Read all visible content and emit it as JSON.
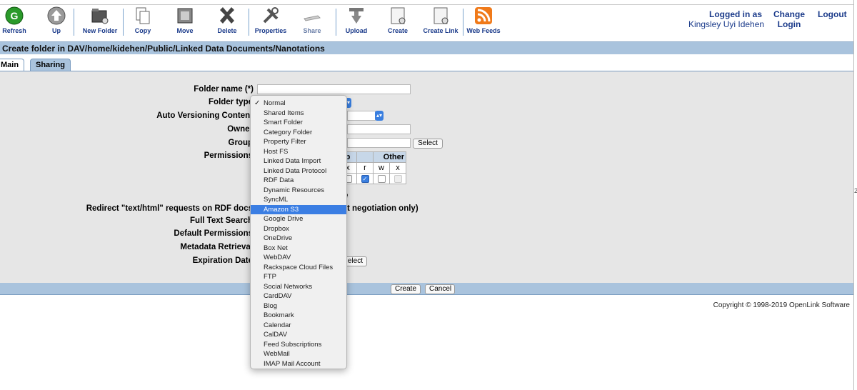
{
  "toolbar": {
    "refresh": "Refresh",
    "up": "Up",
    "new_folder": "New Folder",
    "copy": "Copy",
    "move": "Move",
    "delete": "Delete",
    "properties": "Properties",
    "share": "Share",
    "upload": "Upload",
    "create": "Create",
    "create_link": "Create Link",
    "web_feeds": "Web Feeds"
  },
  "user": {
    "logged_in_as": "Logged in as",
    "name": "Kingsley Uyi Idehen",
    "change_line1": "Change",
    "change_line2": "Login",
    "logout": "Logout"
  },
  "title": "Create folder in DAV/home/kidehen/Public/Linked Data Documents/Nanotations",
  "tabs": {
    "main": "Main",
    "sharing": "Sharing"
  },
  "form": {
    "folder_name_label": "Folder name (*)",
    "folder_type_label": "Folder type",
    "auto_versioning_label": "Auto Versioning Content",
    "owner_label": "Owner",
    "group_label": "Group",
    "group_select": "Select",
    "permissions_label": "Permissions",
    "perm_group_fragment": "p",
    "perm_other": "Other",
    "perm_x": "x",
    "perm_r": "r",
    "perm_w": "w",
    "perm_x2": "x",
    "inherit_fragment": "e",
    "redirect_label": "Redirect \"text/html\" requests on RDF docs",
    "redirect_suffix": "t negotiation only)",
    "full_text_label": "Full Text Search",
    "default_perms_label": "Default Permissions",
    "metadata_label": "Metadata Retrieval",
    "expiration_label": "Expiration Date",
    "expiration_select": "elect"
  },
  "actions": {
    "create": "Create",
    "cancel": "Cancel"
  },
  "copyright": "Copyright © 1998-2019 OpenLink Software",
  "dropdown": {
    "selected": "Normal",
    "highlighted": "Amazon S3",
    "options": [
      "Normal",
      "Shared Items",
      "Smart Folder",
      "Category Folder",
      "Property Filter",
      "Host FS",
      "Linked Data Import",
      "Linked Data Protocol",
      "RDF Data",
      "Dynamic Resources",
      "SyncML",
      "Amazon S3",
      "Google Drive",
      "Dropbox",
      "OneDrive",
      "Box Net",
      "WebDAV",
      "Rackspace Cloud Files",
      "FTP",
      "Social Networks",
      "CardDAV",
      "Blog",
      "Bookmark",
      "Calendar",
      "CalDAV",
      "Feed Subscriptions",
      "WebMail",
      "IMAP Mail Account"
    ]
  },
  "colors": {
    "accent": "#a9c3dd",
    "link": "#1a3a8a",
    "highlight": "#3b7ee3"
  }
}
